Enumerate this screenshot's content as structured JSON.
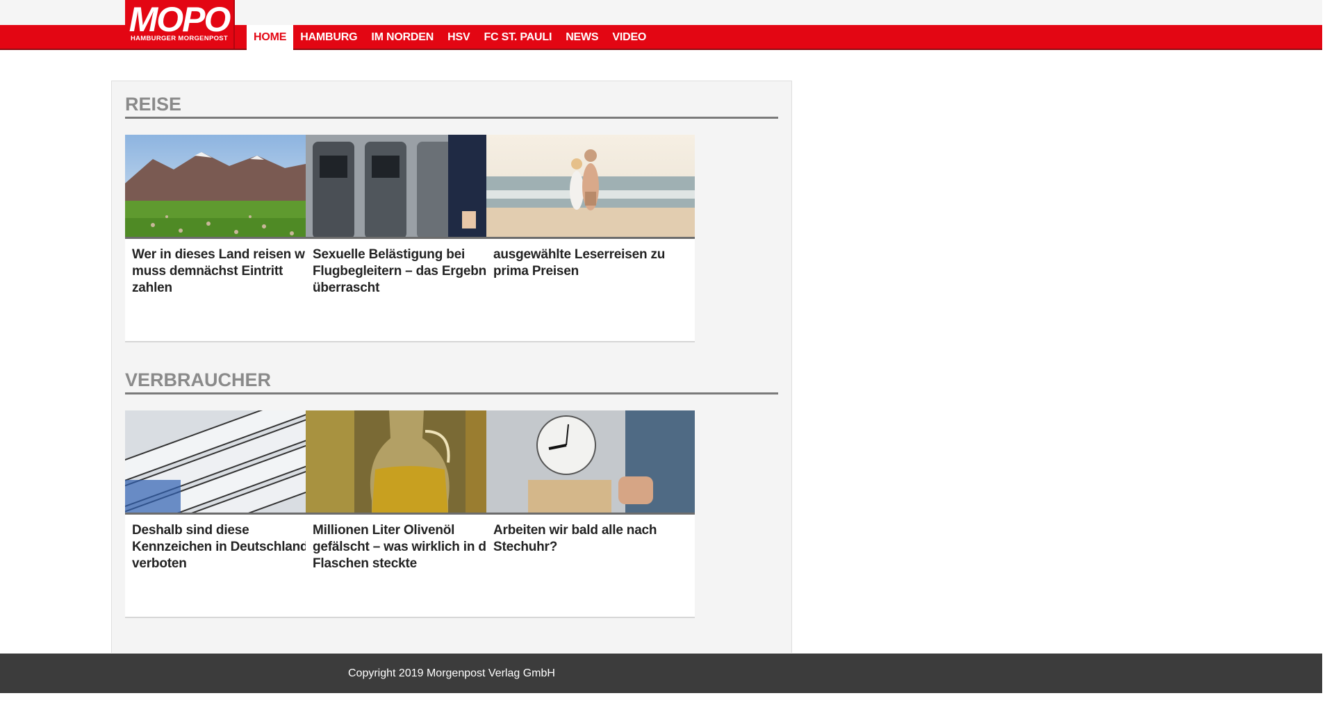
{
  "logo": {
    "main": "MOPO",
    "sub": "HAMBURGER MORGENPOST"
  },
  "nav": {
    "items": [
      {
        "label": "HOME"
      },
      {
        "label": "HAMBURG"
      },
      {
        "label": "IM NORDEN"
      },
      {
        "label": "HSV"
      },
      {
        "label": "FC ST. PAULI"
      },
      {
        "label": "NEWS"
      },
      {
        "label": "VIDEO"
      }
    ]
  },
  "sections": [
    {
      "title": "REISE",
      "cards": [
        {
          "title": "Wer in dieses Land reisen will, muss demnächst Eintritt zahlen",
          "image": "mountain-meadow-sheep-photo"
        },
        {
          "title": "Sexuelle Belästigung bei Flugbegleitern – das Ergebnis überrascht",
          "image": "airplane-seats-flight-attendant-photo"
        },
        {
          "title": "ausgewählte Leserreisen zu prima Preisen",
          "image": "couple-beach-photo"
        }
      ]
    },
    {
      "title": "VERBRAUCHER",
      "cards": [
        {
          "title": "Deshalb sind diese Kennzeichen in Deutschland verboten",
          "image": "license-plates-photo"
        },
        {
          "title": "Millionen Liter Olivenöl gefälscht – was wirklich in den Flaschen steckte",
          "image": "olive-oil-carafe-photo"
        },
        {
          "title": "Arbeiten wir bald alle nach Stechuhr?",
          "image": "time-clock-photo"
        }
      ]
    }
  ],
  "footer": {
    "copyright": "Copyright 2019 Morgenpost Verlag GmbH"
  },
  "colors": {
    "brand_red": "#e30613",
    "footer_bg": "#3c3c3c",
    "panel_bg": "#f4f4f4",
    "section_title": "#8a8a8a"
  }
}
